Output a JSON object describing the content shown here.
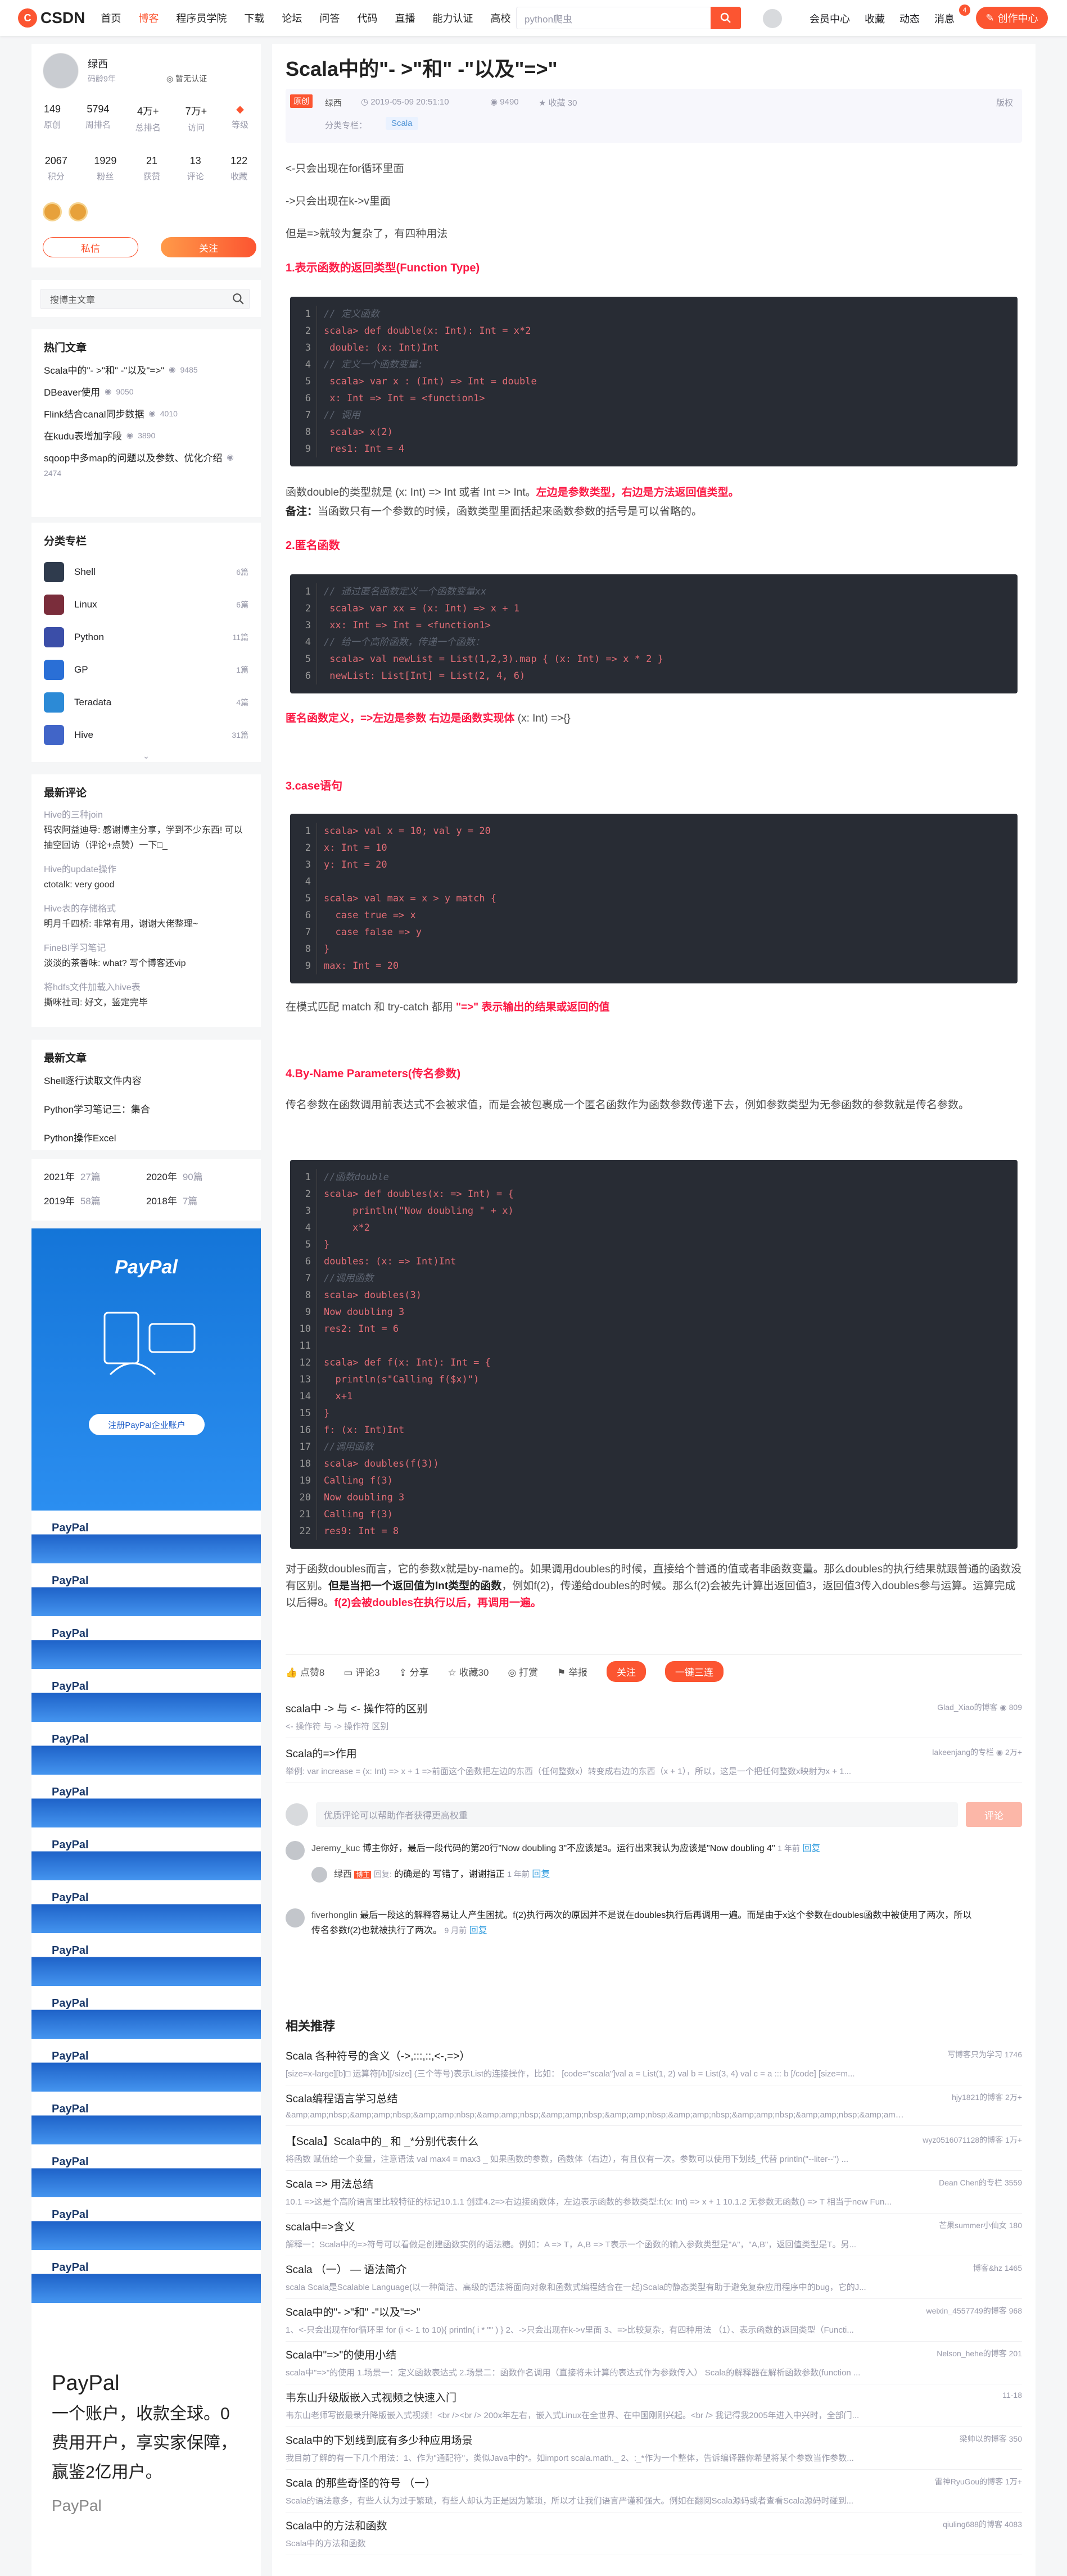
{
  "topbar": {
    "logo": "CSDN",
    "nav": [
      "首页",
      "博客",
      "程序员学院",
      "下载",
      "论坛",
      "问答",
      "代码",
      "直播",
      "能力认证",
      "高校"
    ],
    "search_placeholder": "python爬虫",
    "right": [
      "会员中心",
      "收藏",
      "动态",
      "消息"
    ],
    "msg_count": "4",
    "create": "创作中心"
  },
  "profile": {
    "name": "绿西",
    "years": "码龄9年",
    "cert": "暂无认证",
    "stats1": [
      [
        "149",
        "原创"
      ],
      [
        "5794",
        "周排名"
      ],
      [
        "4万+",
        "总排名"
      ],
      [
        "7万+",
        "访问"
      ],
      [
        "",
        "等级"
      ]
    ],
    "stats2": [
      [
        "2067",
        "积分"
      ],
      [
        "1929",
        "粉丝"
      ],
      [
        "21",
        "获赞"
      ],
      [
        "13",
        "评论"
      ],
      [
        "122",
        "收藏"
      ]
    ],
    "msg_btn": "私信",
    "follow_btn": "关注"
  },
  "side_search_placeholder": "搜博主文章",
  "hot": {
    "title": "热门文章",
    "items": [
      [
        "Scala中的\"- >\"和\" -\"以及\"=>\"",
        "9485"
      ],
      [
        "DBeaver使用",
        "9050"
      ],
      [
        "Flink结合canal同步数据",
        "4010"
      ],
      [
        "在kudu表增加字段",
        "3890"
      ],
      [
        "sqoop中多map的问题以及参数、优化介绍",
        "2474"
      ]
    ]
  },
  "categories": {
    "title": "分类专栏",
    "items": [
      [
        "Shell",
        "6篇",
        "#2f3b4d"
      ],
      [
        "Linux",
        "6篇",
        "#7a2d3b"
      ],
      [
        "Python",
        "11篇",
        "#3b4ea8"
      ],
      [
        "GP",
        "1篇",
        "#2a6fd6"
      ],
      [
        "Teradata",
        "4篇",
        "#2c8ad6"
      ],
      [
        "Hive",
        "31篇",
        "#4165c8"
      ]
    ]
  },
  "comments": {
    "title": "最新评论",
    "items": [
      [
        "Hive的三种join",
        "码农阿益迪导: 感谢博主分享，学到不少东西! 可以抽空回访（评论+点赞）一下□_"
      ],
      [
        "Hive的update操作",
        "ctotalk: very good"
      ],
      [
        "Hive表的存储格式",
        "明月千四桥: 非常有用，谢谢大佬整理~"
      ],
      [
        "FineBI学习笔记",
        "淡淡的茶香味: what? 写个博客还vip"
      ],
      [
        "将hdfs文件加载入hive表",
        "撕咪社司: 好文，鉴定完毕"
      ]
    ]
  },
  "newest": {
    "title": "最新文章",
    "items": [
      "Shell逐行读取文件内容",
      "Python学习笔记三：集合",
      "Python操作Excel"
    ]
  },
  "archive": [
    [
      "2021年",
      "27篇"
    ],
    [
      "2020年",
      "90篇"
    ],
    [
      "2019年",
      "58篇"
    ],
    [
      "2018年",
      "7篇"
    ]
  ],
  "ad": {
    "brand": "PayPal",
    "cta": "注册PayPal企业账户",
    "stripe_text": "PayPal",
    "foot_title": "PayPal",
    "foot_lines": [
      "一个账户，收款全球。0",
      "费用开户，享实家保障，",
      "赢鉴2亿用户。"
    ],
    "foot_mark": "PayPal"
  },
  "article": {
    "title": "Scala中的\"- >\"和\" -\"以及\"=>\"",
    "orig": "原创",
    "author": "绿西",
    "date": "2019-05-09 20:51:10",
    "views": "9490",
    "fav": "收藏 30",
    "copyright": "版权",
    "cat_label": "分类专栏：",
    "tag": "Scala",
    "p1": "<-只会出现在for循环里面",
    "p2": "->只会出现在k->v里面",
    "p3": "但是=>就较为复杂了，有四种用法",
    "h1": "1.表示函数的返回类型(Function Type)",
    "code1": [
      [
        "// 定义函数",
        "cm"
      ],
      [
        "scala> def double(x: Int): Int = x*2",
        ""
      ],
      [
        " double: (x: Int)Int",
        ""
      ],
      [
        "// 定义一个函数变量:",
        "cm"
      ],
      [
        " scala> var x : (Int) => Int = double",
        ""
      ],
      [
        " x: Int => Int = <function1>",
        ""
      ],
      [
        "// 调用",
        "cm"
      ],
      [
        " scala> x(2)",
        ""
      ],
      [
        " res1: Int = 4",
        ""
      ]
    ],
    "p4a": "函数double的类型就是 (x: Int) => Int 或者 Int => Int。",
    "p4b": "左边是参数类型，右边是方法返回值类型。",
    "p5a": "备注：",
    "p5b": "当函数只有一个参数的时候，函数类型里面括起来函数参数的括号是可以省略的。",
    "h2": "2.匿名函数",
    "code2": [
      [
        "// 通过匿名函数定义一个函数变量xx",
        "cm"
      ],
      [
        " scala> var xx = (x: Int) => x + 1",
        ""
      ],
      [
        " xx: Int => Int = <function1>",
        ""
      ],
      [
        "// 给一个高阶函数，传递一个函数：",
        "cm"
      ],
      [
        " scala> val newList = List(1,2,3).map { (x: Int) => x * 2 }",
        ""
      ],
      [
        " newList: List[Int] = List(2, 4, 6)",
        ""
      ]
    ],
    "p6a": "匿名函数定义，=>左边是参数 右边是函数实现体",
    "p6b": "(x: Int)  =>{}",
    "h3": "3.case语句",
    "code3": [
      [
        "scala> val x = 10; val y = 20",
        ""
      ],
      [
        "x: Int = 10",
        ""
      ],
      [
        "y: Int = 20",
        ""
      ],
      [
        "",
        ""
      ],
      [
        "scala> val max = x > y match {",
        ""
      ],
      [
        "  case true => x",
        ""
      ],
      [
        "  case false => y",
        ""
      ],
      [
        "}",
        ""
      ],
      [
        "max: Int = 20",
        ""
      ]
    ],
    "p7a": "在模式匹配 match 和 try-catch 都用 ",
    "p7b": "\"=>\" 表示输出的结果或返回的值",
    "h4": "4.By-Name Parameters(传名参数)",
    "p8": "传名参数在函数调用前表达式不会被求值，而是会被包裹成一个匿名函数作为函数参数传递下去，例如参数类型为无参函数的参数就是传名参数。",
    "code4": [
      [
        "//函数double",
        "cm"
      ],
      [
        "scala> def doubles(x: => Int) = {",
        ""
      ],
      [
        "     println(\"Now doubling \" + x)",
        ""
      ],
      [
        "     x*2",
        ""
      ],
      [
        "}",
        ""
      ],
      [
        "doubles: (x: => Int)Int",
        ""
      ],
      [
        "//调用函数",
        "cm"
      ],
      [
        "scala> doubles(3)",
        ""
      ],
      [
        "Now doubling 3",
        ""
      ],
      [
        "res2: Int = 6",
        ""
      ],
      [
        "",
        ""
      ],
      [
        "scala> def f(x: Int): Int = {",
        ""
      ],
      [
        "  println(s\"Calling f($x)\")",
        ""
      ],
      [
        "  x+1",
        ""
      ],
      [
        "}",
        ""
      ],
      [
        "f: (x: Int)Int",
        ""
      ],
      [
        "//调用函数",
        "cm"
      ],
      [
        "scala> doubles(f(3))",
        ""
      ],
      [
        "Calling f(3)",
        ""
      ],
      [
        "Now doubling 3",
        ""
      ],
      [
        "Calling f(3)",
        ""
      ],
      [
        "res9: Int = 8",
        ""
      ]
    ],
    "p9a": "对于函数doubles而言，它的参数x就是by-name的。如果调用doubles的时候，直接给个普通的值或者非函数变量。那么doubles的执行结果就跟普通的函数没有区别。",
    "p9b": "但是当把一个返回值为Int类型的函数",
    "p9c": "，例如f(2)，传递给doubles的时候。那么f(2)会被先计算出返回值3，返回值3传入doubles参与运算。运算完成以后得8。",
    "p9d": "f(2)会被doubles在执行以后，再调用一遍。"
  },
  "toolbar": {
    "like": "点赞8",
    "comment": "评论3",
    "share": "分享",
    "fav": "收藏30",
    "reward": "打赏",
    "report": "举报",
    "follow": "关注",
    "triple": "一键三连"
  },
  "related_top": [
    [
      "scala中 -> 与 <- 操作符的区别",
      "<- 操作符 与 -> 操作符 区别",
      "Glad_Xiao的博客",
      "809"
    ],
    [
      "Scala的=>作用",
      "举例:   var increase = (x: Int) => x + 1 =>前面这个函数把左边的东西（任何整数x）转变成右边的东西（x + 1），所以，这是一个把任何整数x映射为x + 1...",
      "lakeenjang的专栏",
      "2万+"
    ]
  ],
  "comment_box": {
    "placeholder": "优质评论可以帮助作者获得更高权重",
    "btn": "评论"
  },
  "comment_list": [
    {
      "user": "Jeremy_kuc",
      "text": "博主你好，最后一段代码的第20行\"Now doubling 3\"不应该是3。运行出来我认为应该是\"Now doubling 4\"",
      "time": "1 年前",
      "reply": "回复"
    },
    {
      "user": "绿西",
      "tag": "博主",
      "to": "回复:",
      "text": "的确是的 写错了，谢谢指正",
      "time": "1 年前",
      "reply": "回复"
    },
    {
      "user": "fiverhonglin",
      "text": "最后一段这的解释容易让人产生困扰。f(2)执行两次的原因并不是说在doubles执行后再调用一遍。而是由于x这个参数在doubles函数中被使用了两次，所以传名参数f(2)也就被执行了两次。",
      "time": "9 月前",
      "reply": "回复"
    }
  ],
  "recs_title": "相关推荐",
  "recs": [
    [
      "Scala 各种符号的含义（->,:::,::,<-,=>）",
      "[size=x-large][b]□ 运算符[/b][/size] (三个等号)表示List的连接操作，比如： [code=\"scala\"]val a = List(1, 2) val b = List(3, 4) val c = a ::: b [/code] [size=m...",
      "写博客只为学习",
      "1746"
    ],
    [
      "Scala编程语言学习总结",
      "&amp;amp;nbsp;&amp;amp;nbsp;&amp;amp;nbsp;&amp;amp;nbsp;&amp;amp;nbsp;&amp;amp;nbsp;&amp;amp;nbsp;&amp;amp;nbsp;&amp;amp;nbsp;&amp;amp;nbsp;&amp;amp;nbsp;&amp;amp;nbsp;&amp;amp;nbsp;&amp;amp;nbs...",
      "hjy1821的博客",
      "2万+"
    ],
    [
      "【Scala】Scala中的_ 和 _*分别代表什么",
      "将函数 赋值给一个变量，注意语法 val max4 = max3 _ 如果函数的参数，函数体（右边），有且仅有一次。参数可以使用下划线_代替 println(\"--liter--\") ...",
      "wyz0516071128的博客",
      "1万+"
    ],
    [
      "Scala => 用法总结",
      "10.1 =>这是个高阶语言里比较特征的标记10.1.1 创建4.2=>右边接函数体，左边表示函数的参数类型:f:(x: Int) => x + 1 10.1.2 无参数无函数() => T 相当于new Fun...",
      "Dean Chen的专栏",
      "3559"
    ],
    [
      "scala中=>含义",
      "解释一：Scala中的=>符号可以看做是创建函数实例的语法糖。例如：A => T，A,B => T表示一个函数的输入参数类型是\"A\"，\"A,B\"，返回值类型是T。另...",
      "芒果summer小仙女",
      "180"
    ],
    [
      "Scala （一） — 语法简介",
      "scala Scala是Scalable Language(以一种简洁、高级的语法将面向对象和函数式编程结合在一起)Scala的静态类型有助于避免复杂应用程序中的bug，它的J...",
      "博客&hz",
      "1465"
    ],
    [
      "Scala中的\"- >\"和\" -\"以及\"=>\"",
      "1、<-只会出现在for循环里 for (i <- 1 to 10){ println( i * \"\" ) } 2、->只会出现在k->v里面 3、=>比较复杂，有四种用法 （1）、表示函数的返回类型（Functi...",
      "weixin_4557749的博客",
      "968"
    ],
    [
      "Scala中\"=>\"的使用小结",
      "scala中\"=>\"的使用 1.场景一：定义函数表达式 2.场景二：函数作名调用（直接将未计算的表达式作为参数传入） Scala的解释器在解析函数参数(function ...",
      "Nelson_hehe的博客",
      "201"
    ],
    [
      "韦东山升级版嵌入式视频之快速入门",
      "韦东山老师写嵌最录升降版嵌入式视频！<br /><br /> 200x年左右，嵌入式Linux在全世界、在中国刚刚兴起。<br /> 我记得我2005年进入中兴时，全部门...",
      "",
      "11-18"
    ],
    [
      "Scala中的下划线到底有多少种应用场景",
      "我目前了解的有一下几个用法：1、作为\"通配符\"，类似Java中的*。如import scala.math._ 2、:_*作为一个整体，告诉编译器你希望将某个参数当作参数...",
      "梁帅以的博客",
      "350"
    ],
    [
      "Scala 的那些奇怪的符号 （一）",
      "Scala的语法意多，有些人认为过于繁琐，有些人却认为正是因为繁琐，所以才让我们语言严谨和强大。例如在翻阅Scala源码或者查看Scala源码时碰到...",
      "雷神RyuGou的博客",
      "1万+"
    ],
    [
      "Scala中的方法和函数",
      "Scala中的方法和函数",
      "qiuling688的博客",
      "4083"
    ]
  ]
}
